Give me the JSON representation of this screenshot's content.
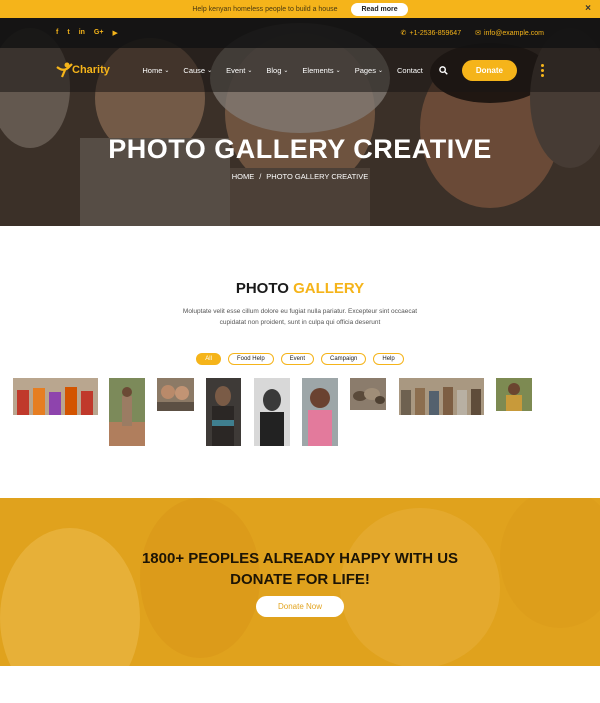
{
  "notice": {
    "text": "Help kenyan homeless people to build a house",
    "button": "Read more",
    "close": "×"
  },
  "topbar": {
    "phone": "+1-2536-859647",
    "email": "info@example.com",
    "socials": [
      "f",
      "t",
      "in",
      "G+",
      "▶"
    ]
  },
  "brand": {
    "name": "Charity",
    "color": "#f5b41a"
  },
  "nav": {
    "items": [
      {
        "label": "Home",
        "caret": "⌄"
      },
      {
        "label": "Cause",
        "caret": "⌄"
      },
      {
        "label": "Event",
        "caret": "⌄"
      },
      {
        "label": "Blog",
        "caret": "⌄"
      },
      {
        "label": "Elements",
        "caret": "⌄"
      },
      {
        "label": "Pages",
        "caret": "⌄"
      },
      {
        "label": "Contact",
        "caret": ""
      }
    ],
    "donate": "Donate"
  },
  "hero": {
    "title": "PHOTO GALLERY CREATIVE",
    "crumb_home": "HOME",
    "crumb_sep": "/",
    "crumb_current": "PHOTO GALLERY CREATIVE"
  },
  "gallery": {
    "title_main": "PHOTO",
    "title_accent": "GALLERY",
    "description": "Moluptate velit esse cillum dolore eu fugiat nulla pariatur. Excepteur sint occaecat cupidatat non proident, sunt in culpa qui officia deserunt",
    "filters": [
      "All",
      "Food Help",
      "Event",
      "Campaign",
      "Help"
    ],
    "active_filter": "All"
  },
  "cta": {
    "line1": "1800+ PEOPLES ALREADY HAPPY WITH US",
    "line2": "DONATE FOR LIFE!",
    "button": "Donate Now"
  }
}
